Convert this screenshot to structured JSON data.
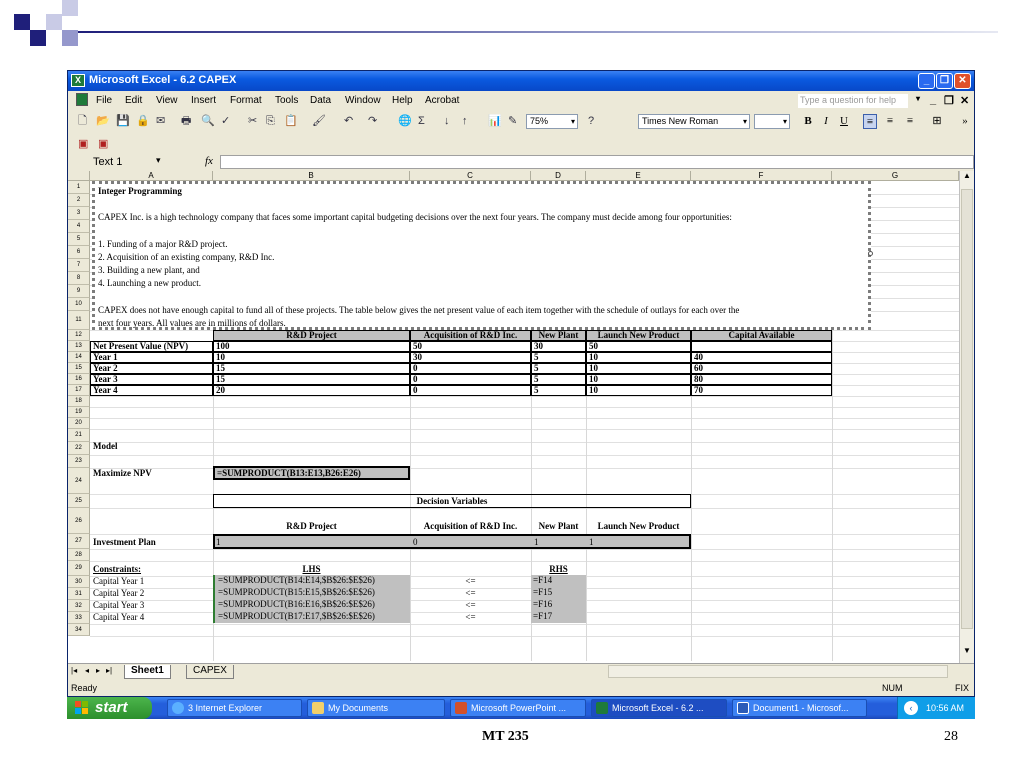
{
  "window": {
    "title": "Microsoft Excel - 6.2 CAPEX"
  },
  "menu": [
    "File",
    "Edit",
    "View",
    "Insert",
    "Format",
    "Tools",
    "Data",
    "Window",
    "Help",
    "Acrobat"
  ],
  "help_placeholder": "Type a question for help",
  "toolbar": {
    "zoom": "75%",
    "font": "Times New Roman"
  },
  "namebox": "Text 1",
  "columns": [
    "A",
    "B",
    "C",
    "D",
    "E",
    "F",
    "G"
  ],
  "rows": [
    "1",
    "2",
    "3",
    "4",
    "5",
    "6",
    "7",
    "8",
    "9",
    "10",
    "11",
    "12",
    "13",
    "14",
    "15",
    "16",
    "17",
    "18",
    "19",
    "20",
    "21",
    "22",
    "23",
    "24",
    "25",
    "26",
    "27",
    "28",
    "29",
    "30",
    "31",
    "32",
    "33",
    "34"
  ],
  "textbox": {
    "title": "Integer Programming",
    "intro": "CAPEX Inc. is a high technology company that faces some important capital budgeting decisions over the next four years.  The company must decide among four opportunities:",
    "items": [
      "1. Funding of a major R&D project.",
      "2. Acquisition of an existing company, R&D Inc.",
      "3. Building a new plant, and",
      "4. Launching a new product."
    ],
    "para1": "CAPEX does not have enough capital to fund all of these projects.  The table below gives the net present value of each item together with the schedule of outlays for each over the",
    "para2": "next four years.  All values are in millions of dollars."
  },
  "table": {
    "headers": [
      "R&D Project",
      "Acquisition of R&D Inc.",
      "New Plant",
      "Launch New Product",
      "Capital Available"
    ],
    "rows": [
      {
        "label": "Net Present Value (NPV)",
        "b": "100",
        "c": "50",
        "d": "30",
        "e": "50",
        "f": ""
      },
      {
        "label": "Year 1",
        "b": "10",
        "c": "30",
        "d": "5",
        "e": "10",
        "f": "40"
      },
      {
        "label": "Year 2",
        "b": "15",
        "c": "0",
        "d": "5",
        "e": "10",
        "f": "60"
      },
      {
        "label": "Year 3",
        "b": "15",
        "c": "0",
        "d": "5",
        "e": "10",
        "f": "80"
      },
      {
        "label": "Year 4",
        "b": "20",
        "c": "0",
        "d": "5",
        "e": "10",
        "f": "70"
      }
    ]
  },
  "model": {
    "label": "Model",
    "maximize_label": "Maximize NPV",
    "maximize_formula": "=SUMPRODUCT(B13:E13,B26:E26)",
    "decision_variables": "Decision Variables",
    "dv_headers": [
      "R&D Project",
      "Acquisition of R&D Inc.",
      "New Plant",
      "Launch New Product"
    ],
    "plan_label": "Investment Plan",
    "plan_values": [
      "1",
      "0",
      "1",
      "1"
    ],
    "constraints_label": "Constraints:",
    "lhs": "LHS",
    "rhs": "RHS",
    "constraints": [
      {
        "label": "Capital Year 1",
        "lhs": "=SUMPRODUCT(B14:E14,$B$26:$E$26)",
        "op": "<=",
        "rhs": "=F14"
      },
      {
        "label": "Capital Year 2",
        "lhs": "=SUMPRODUCT(B15:E15,$B$26:$E$26)",
        "op": "<=",
        "rhs": "=F15"
      },
      {
        "label": "Capital Year 3",
        "lhs": "=SUMPRODUCT(B16:E16,$B$26:$E$26)",
        "op": "<=",
        "rhs": "=F16"
      },
      {
        "label": "Capital Year 4",
        "lhs": "=SUMPRODUCT(B17:E17,$B$26:$E$26)",
        "op": "<=",
        "rhs": "=F17"
      }
    ]
  },
  "sheets": [
    "Sheet1",
    "CAPEX"
  ],
  "status": {
    "left": "Ready",
    "num": "NUM",
    "fix": "FIX"
  },
  "taskbar": {
    "start": "start",
    "tasks": [
      "3 Internet Explorer",
      "My Documents",
      "Microsoft PowerPoint ...",
      "Microsoft Excel - 6.2 ...",
      "Document1 - Microsof..."
    ],
    "clock": "10:56 AM"
  },
  "footer": {
    "center": "MT 235",
    "page": "28"
  }
}
